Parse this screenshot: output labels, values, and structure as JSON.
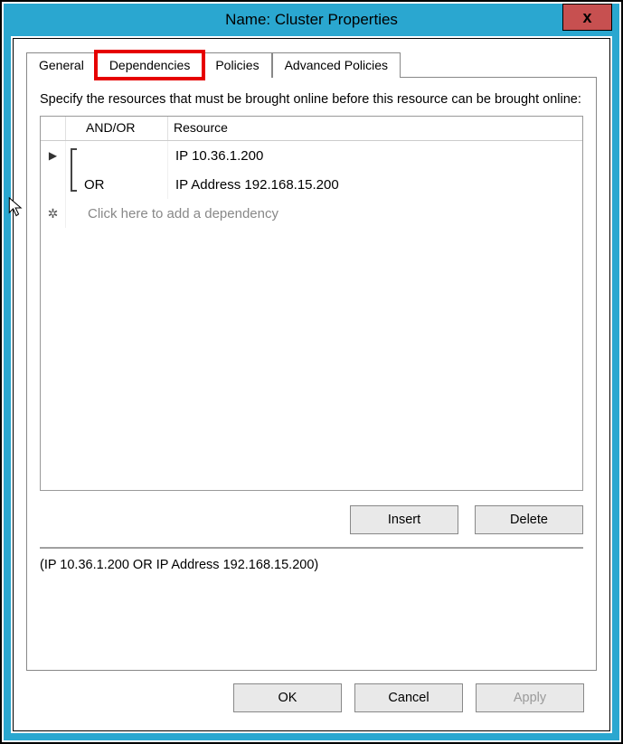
{
  "window": {
    "title": "Name: Cluster Properties",
    "close_label": "x"
  },
  "tabs": [
    {
      "label": "General"
    },
    {
      "label": "Dependencies"
    },
    {
      "label": "Policies"
    },
    {
      "label": "Advanced Policies"
    }
  ],
  "instruction": "Specify the resources that must be brought online before this resource can be brought online:",
  "grid": {
    "headers": {
      "andor": "AND/OR",
      "resource": "Resource"
    },
    "rows": [
      {
        "marker": "current",
        "andor": "",
        "resource": "IP 10.36.1.200"
      },
      {
        "marker": "",
        "andor": "OR",
        "resource": "IP Address 192.168.15.200"
      }
    ],
    "placeholder": "Click here to add a dependency"
  },
  "buttons": {
    "insert": "Insert",
    "delete": "Delete",
    "ok": "OK",
    "cancel": "Cancel",
    "apply": "Apply"
  },
  "expression": "(IP 10.36.1.200  OR IP Address 192.168.15.200)"
}
